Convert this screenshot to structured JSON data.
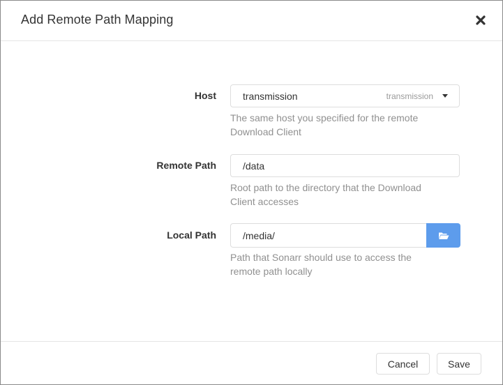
{
  "modal": {
    "title": "Add Remote Path Mapping"
  },
  "form": {
    "host": {
      "label": "Host",
      "value": "transmission",
      "hint": "transmission",
      "help": "The same host you specified for the remote Download Client"
    },
    "remote_path": {
      "label": "Remote Path",
      "value": "/data",
      "help": "Root path to the directory that the Download Client accesses"
    },
    "local_path": {
      "label": "Local Path",
      "value": "/media/",
      "help": "Path that Sonarr should use to access the remote path locally"
    }
  },
  "footer": {
    "cancel_label": "Cancel",
    "save_label": "Save"
  },
  "icons": {
    "close": "close-icon",
    "dropdown": "caret-down-icon",
    "browse": "folder-open-icon"
  },
  "colors": {
    "accent": "#5d9cec",
    "help_text": "#909090",
    "border": "#dddddd"
  }
}
